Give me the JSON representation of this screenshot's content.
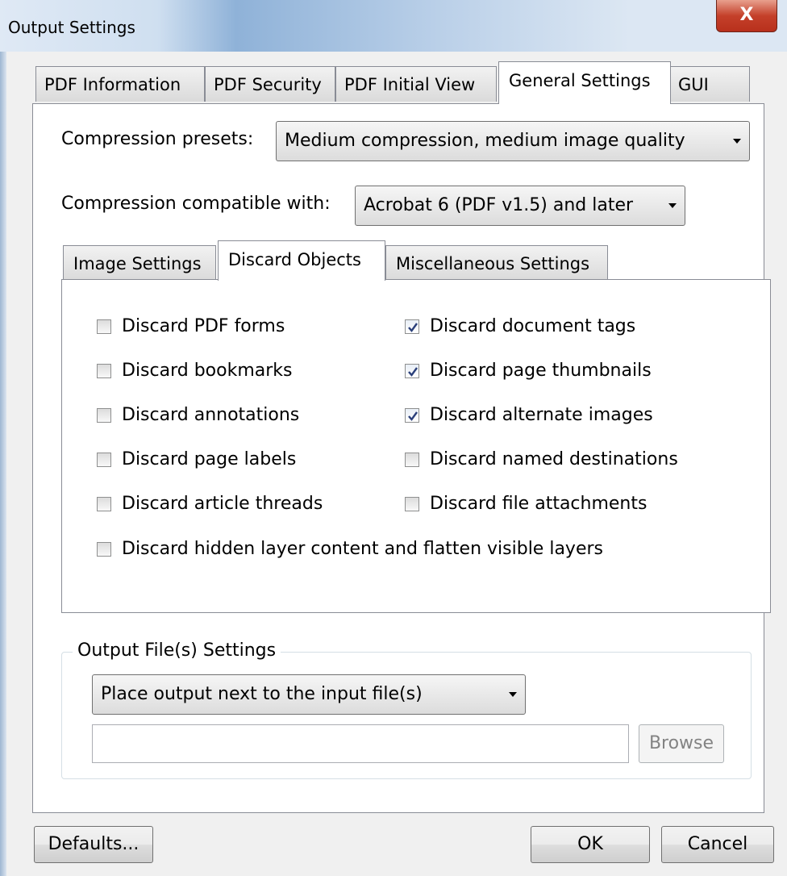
{
  "window": {
    "title": "Output Settings",
    "close_glyph": "X"
  },
  "main_tabs": [
    {
      "label": "PDF Information"
    },
    {
      "label": "PDF Security"
    },
    {
      "label": "PDF Initial View"
    },
    {
      "label": "General Settings"
    },
    {
      "label": "GUI"
    }
  ],
  "compression": {
    "presets_label": "Compression presets:",
    "presets_value": "Medium compression, medium image quality",
    "compatible_label": "Compression compatible with:",
    "compatible_value": "Acrobat 6 (PDF v1.5) and later"
  },
  "sub_tabs": [
    {
      "label": "Image Settings"
    },
    {
      "label": "Discard Objects"
    },
    {
      "label": "Miscellaneous Settings"
    }
  ],
  "discard_options": [
    {
      "label": "Discard PDF forms",
      "checked": false
    },
    {
      "label": "Discard document tags",
      "checked": true
    },
    {
      "label": "Discard bookmarks",
      "checked": false
    },
    {
      "label": "Discard page thumbnails",
      "checked": true
    },
    {
      "label": "Discard annotations",
      "checked": false
    },
    {
      "label": "Discard alternate images",
      "checked": true
    },
    {
      "label": "Discard page labels",
      "checked": false
    },
    {
      "label": "Discard named destinations",
      "checked": false
    },
    {
      "label": "Discard article threads",
      "checked": false
    },
    {
      "label": "Discard file attachments",
      "checked": false
    },
    {
      "label": "Discard hidden layer content and flatten visible layers",
      "checked": false
    }
  ],
  "output": {
    "group_title": "Output File(s) Settings",
    "location_value": "Place output next to the input file(s)",
    "path_value": "",
    "browse_label": "Browse"
  },
  "footer": {
    "defaults_label": "Defaults...",
    "ok_label": "OK",
    "cancel_label": "Cancel"
  },
  "colors": {
    "check_mark": "#2a3f7a",
    "accent": "#3c7fb1"
  }
}
